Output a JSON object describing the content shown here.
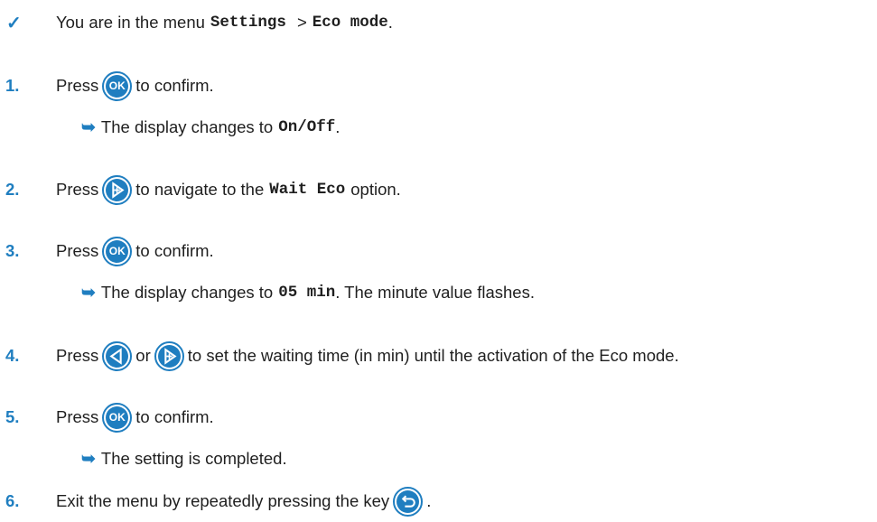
{
  "colors": {
    "accent": "#1f7ec0",
    "text": "#1f1f1f"
  },
  "precondition": {
    "icon": "check-mark",
    "text_before": "You are in the menu",
    "menu": "Settings",
    "separator": ">",
    "submenu": "Eco mode",
    "end": "."
  },
  "steps": [
    {
      "number": "1.",
      "press": "Press",
      "key": "ok-key",
      "key_label": "OK",
      "after": "to confirm.",
      "result": {
        "text_before": "The display changes to",
        "value": "On/Off",
        "end": "."
      }
    },
    {
      "number": "2.",
      "press": "Press",
      "key": "right-arrow-key",
      "after_before": "to navigate to the",
      "value": "Wait Eco",
      "after_end": "option."
    },
    {
      "number": "3.",
      "press": "Press",
      "key": "ok-key",
      "key_label": "OK",
      "after": "to confirm.",
      "result": {
        "text_before": "The display changes to",
        "value": "05 min",
        "end": ". The minute value flashes."
      }
    },
    {
      "number": "4.",
      "press": "Press",
      "key_a": "left-arrow-key",
      "or": "or",
      "key_b": "right-arrow-key",
      "after": "to set the waiting time (in min) until the activation of the Eco mode."
    },
    {
      "number": "5.",
      "press": "Press",
      "key": "ok-key",
      "key_label": "OK",
      "after": "to confirm.",
      "result": {
        "text": "The setting is completed."
      }
    },
    {
      "number": "6.",
      "text": "Exit the menu by repeatedly pressing the key",
      "key": "back-key",
      "end": "."
    }
  ],
  "result_icon": "result-arrow"
}
